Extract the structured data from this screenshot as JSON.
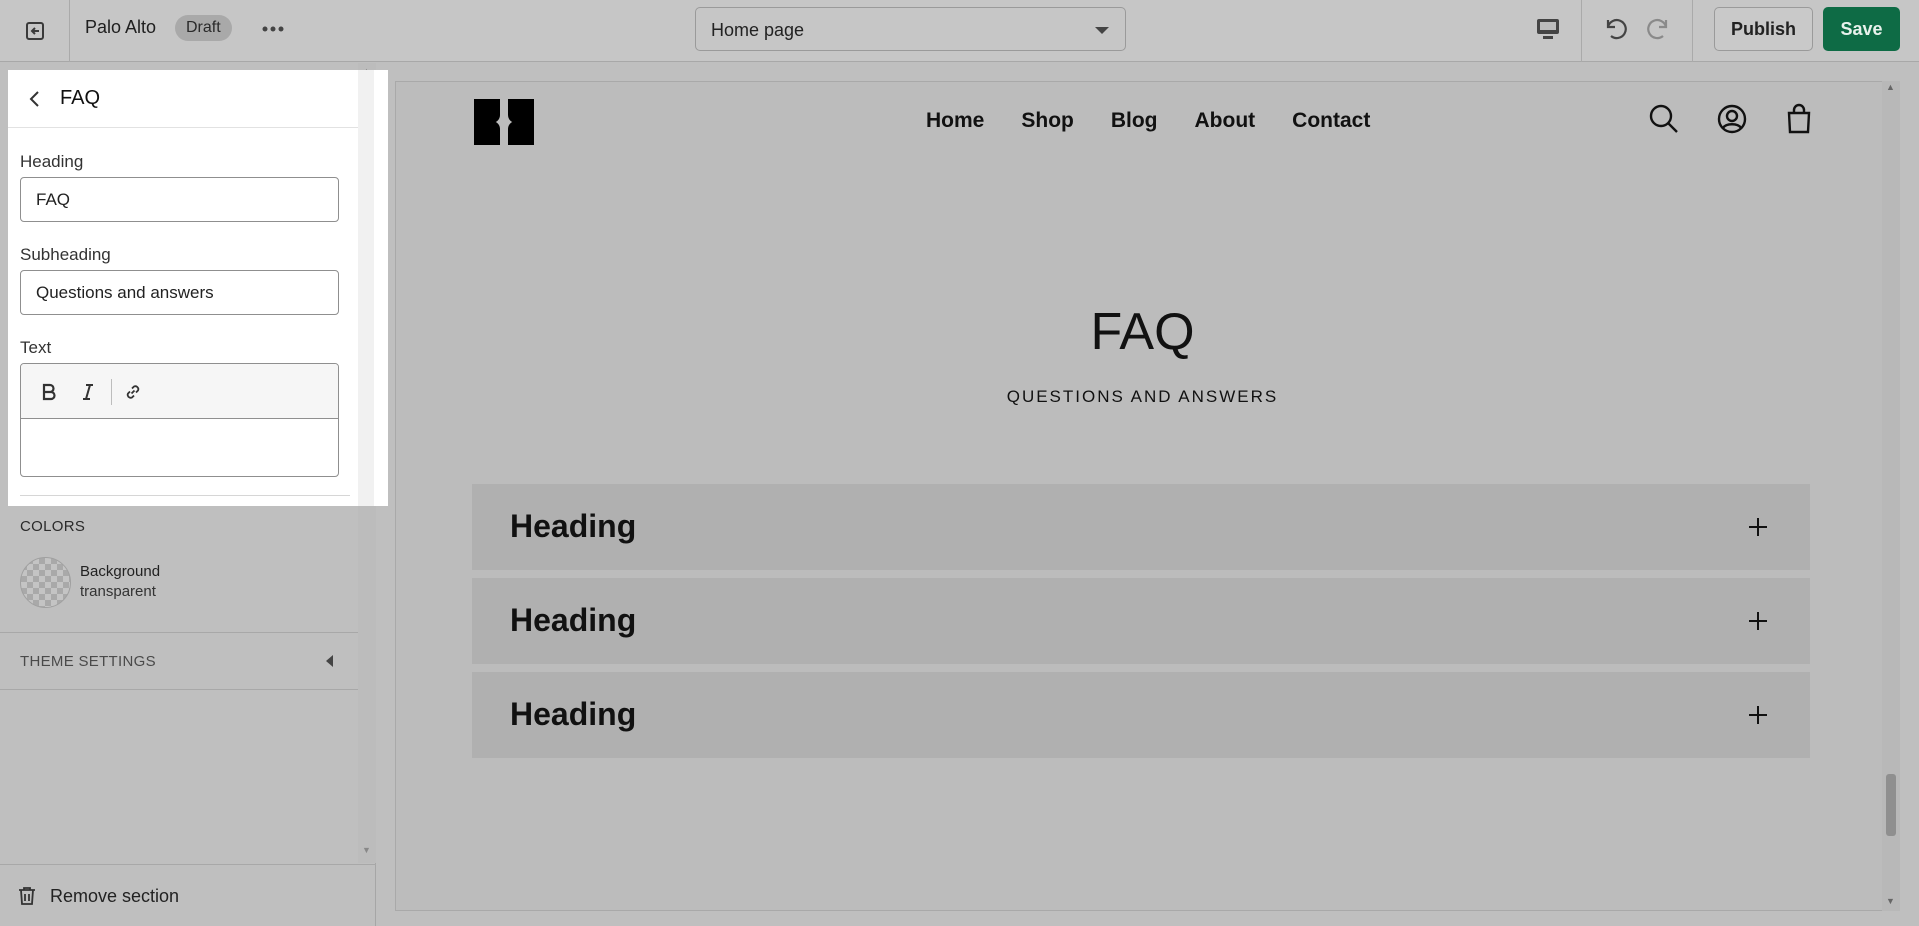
{
  "topbar": {
    "store_name": "Palo Alto",
    "status_badge": "Draft",
    "page_select": "Home page",
    "publish_label": "Publish",
    "save_label": "Save",
    "save_color": "#0e6b45"
  },
  "panel": {
    "title": "FAQ",
    "heading_label": "Heading",
    "heading_value": "FAQ",
    "subheading_label": "Subheading",
    "subheading_value": "Questions and answers",
    "text_label": "Text",
    "text_value": "",
    "toolbar_icons": [
      "bold-icon",
      "italic-icon",
      "link-icon"
    ]
  },
  "sidebar": {
    "colors_label": "COLORS",
    "background_label": "Background",
    "background_value": "transparent",
    "theme_settings_label": "THEME SETTINGS",
    "remove_section_label": "Remove section"
  },
  "preview": {
    "nav": [
      "Home",
      "Shop",
      "Blog",
      "About",
      "Contact"
    ],
    "header_icons": [
      "search-icon",
      "account-icon",
      "cart-icon"
    ],
    "faq_title": "FAQ",
    "faq_subtitle": "QUESTIONS AND ANSWERS",
    "accordion": [
      {
        "heading": "Heading"
      },
      {
        "heading": "Heading"
      },
      {
        "heading": "Heading"
      }
    ]
  }
}
